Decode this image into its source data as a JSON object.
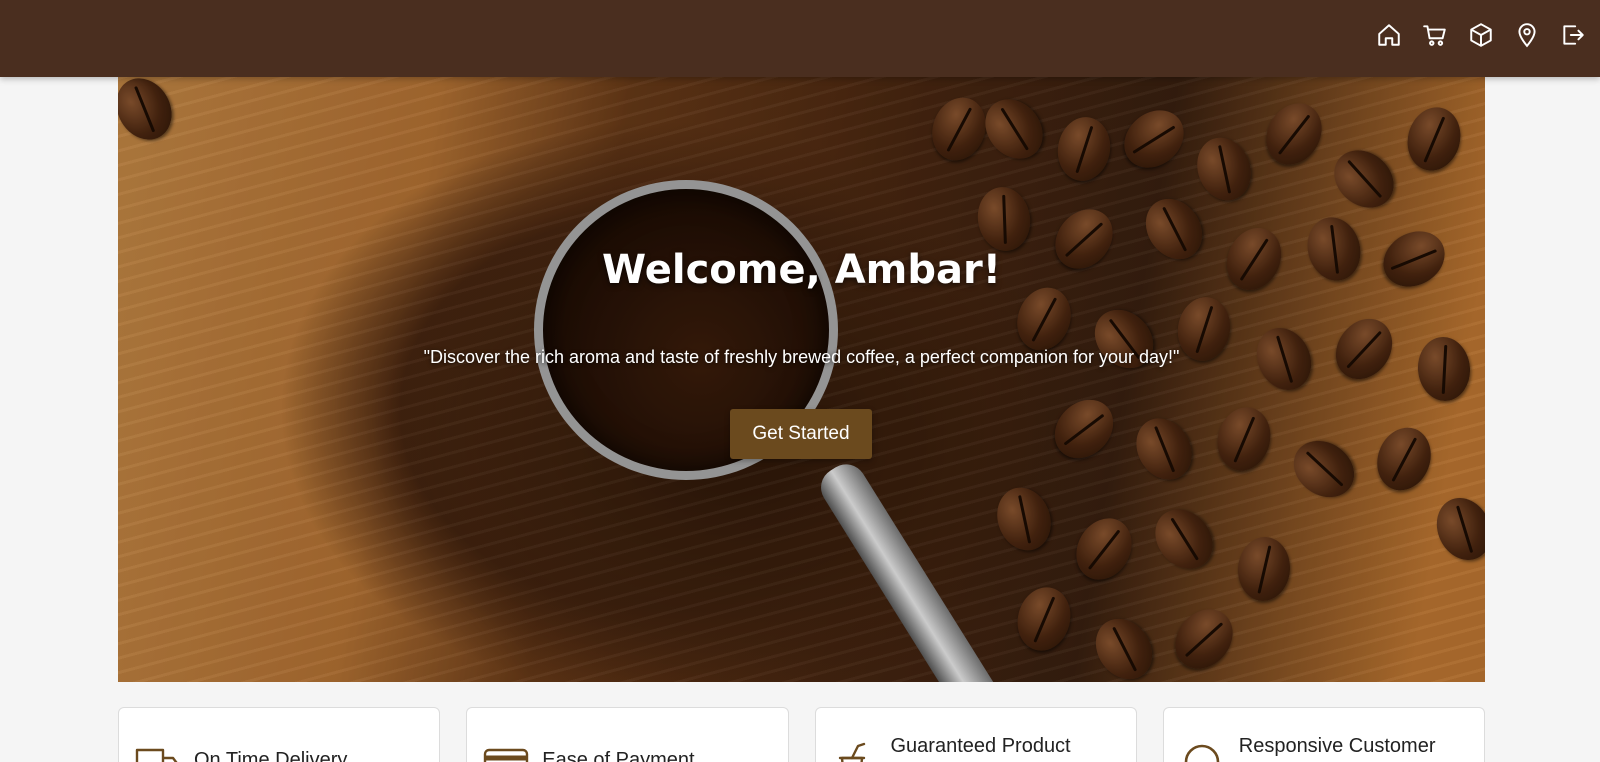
{
  "navbar": {
    "icons": [
      "home-icon",
      "cart-icon",
      "box-icon",
      "location-icon",
      "logout-icon"
    ]
  },
  "hero": {
    "title": "Welcome, Ambar!",
    "subtitle": "\"Discover the rich aroma and taste of freshly brewed coffee, a perfect companion for your day!\"",
    "button_label": "Get Started"
  },
  "features": [
    {
      "title": "On Time Delivery",
      "icon": "truck-icon"
    },
    {
      "title": "Ease of Payment",
      "icon": "credit-card-icon"
    },
    {
      "title": "Guaranteed Product Quality",
      "icon": "cup-icon"
    },
    {
      "title": "Responsive Customer Service",
      "icon": "headset-icon"
    }
  ],
  "colors": {
    "navbar": "#4a2e1f",
    "button": "#6b4a1e",
    "page_bg": "#f5f5f5"
  }
}
